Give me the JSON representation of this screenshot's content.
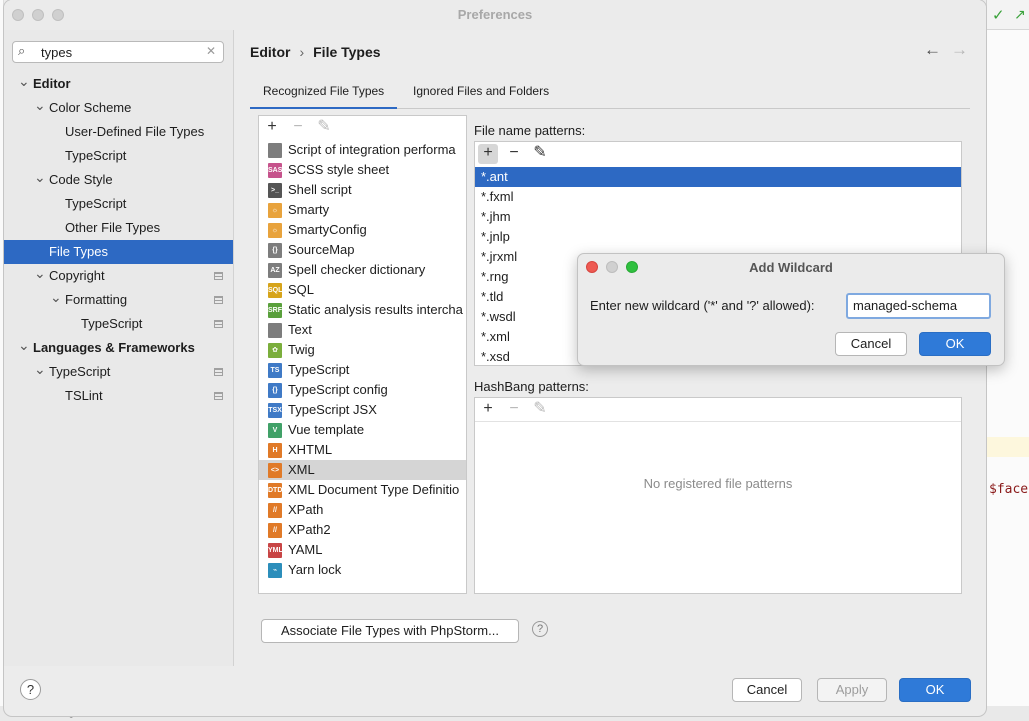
{
  "window": {
    "title": "Preferences"
  },
  "search": {
    "value": "types"
  },
  "sidebar": {
    "items": [
      {
        "label": "Editor",
        "level": 0,
        "expanded": true,
        "bold": true
      },
      {
        "label": "Color Scheme",
        "level": 1,
        "expanded": true
      },
      {
        "label": "User-Defined File Types",
        "level": 2
      },
      {
        "label": "TypeScript",
        "level": 2
      },
      {
        "label": "Code Style",
        "level": 1,
        "expanded": true
      },
      {
        "label": "TypeScript",
        "level": 2
      },
      {
        "label": "Other File Types",
        "level": 2
      },
      {
        "label": "File Types",
        "level": 1,
        "selected": true
      },
      {
        "label": "Copyright",
        "level": 1,
        "expanded": true,
        "project": true
      },
      {
        "label": "Formatting",
        "level": 2,
        "expanded": true,
        "project": true
      },
      {
        "label": "TypeScript",
        "level": 3,
        "project": true
      },
      {
        "label": "Languages & Frameworks",
        "level": 0,
        "expanded": true,
        "bold": true
      },
      {
        "label": "TypeScript",
        "level": 1,
        "expanded": true,
        "project": true
      },
      {
        "label": "TSLint",
        "level": 2,
        "project": true
      }
    ]
  },
  "breadcrumb": {
    "parent": "Editor",
    "separator": "›",
    "current": "File Types"
  },
  "nav": {
    "back": "←",
    "forward": "→"
  },
  "tabs": [
    {
      "label": "Recognized File Types",
      "active": true
    },
    {
      "label": "Ignored Files and Folders",
      "active": false
    }
  ],
  "toolbar": {
    "add": "+",
    "remove": "−",
    "edit": "✎"
  },
  "file_types": [
    {
      "name": "Script of integration performa",
      "icon": "script-icon",
      "tag": "",
      "color": "#7d7d7d"
    },
    {
      "name": "SCSS style sheet",
      "icon": "scss-icon",
      "tag": "SASS",
      "color": "#c6538c"
    },
    {
      "name": "Shell script",
      "icon": "shell-icon",
      "tag": ">_",
      "color": "#555555"
    },
    {
      "name": "Smarty",
      "icon": "smarty-icon",
      "tag": "☼",
      "color": "#e8a33d"
    },
    {
      "name": "SmartyConfig",
      "icon": "smarty-config-icon",
      "tag": "☼",
      "color": "#e8a33d"
    },
    {
      "name": "SourceMap",
      "icon": "sourcemap-icon",
      "tag": "{}",
      "color": "#7d7d7d"
    },
    {
      "name": "Spell checker dictionary",
      "icon": "dictionary-icon",
      "tag": "AZ",
      "color": "#7d7d7d"
    },
    {
      "name": "SQL",
      "icon": "sql-icon",
      "tag": "SQL",
      "color": "#d6a41b"
    },
    {
      "name": "Static analysis results intercha",
      "icon": "sarif-icon",
      "tag": "SRF",
      "color": "#5aa03c"
    },
    {
      "name": "Text",
      "icon": "text-icon",
      "tag": "",
      "color": "#7d7d7d"
    },
    {
      "name": "Twig",
      "icon": "twig-icon",
      "tag": "✿",
      "color": "#7bae3c"
    },
    {
      "name": "TypeScript",
      "icon": "typescript-icon",
      "tag": "TS",
      "color": "#3f7ac6"
    },
    {
      "name": "TypeScript config",
      "icon": "tsconfig-icon",
      "tag": "{}",
      "color": "#3f7ac6"
    },
    {
      "name": "TypeScript JSX",
      "icon": "tsx-icon",
      "tag": "TSX",
      "color": "#3f7ac6"
    },
    {
      "name": "Vue template",
      "icon": "vue-icon",
      "tag": "V",
      "color": "#41a168"
    },
    {
      "name": "XHTML",
      "icon": "xhtml-icon",
      "tag": "H",
      "color": "#e07a28"
    },
    {
      "name": "XML",
      "icon": "xml-icon",
      "tag": "<>",
      "color": "#e07a28",
      "selected": true
    },
    {
      "name": "XML Document Type Definitio",
      "icon": "dtd-icon",
      "tag": "DTD",
      "color": "#e07a28"
    },
    {
      "name": "XPath",
      "icon": "xpath-icon",
      "tag": "//",
      "color": "#e07a28"
    },
    {
      "name": "XPath2",
      "icon": "xpath2-icon",
      "tag": "//",
      "color": "#e07a28"
    },
    {
      "name": "YAML",
      "icon": "yaml-icon",
      "tag": "YML",
      "color": "#c84545"
    },
    {
      "name": "Yarn lock",
      "icon": "yarn-icon",
      "tag": "⌁",
      "color": "#2c8ebb"
    }
  ],
  "patterns": {
    "label": "File name patterns:",
    "items": [
      "*.ant",
      "*.fxml",
      "*.jhm",
      "*.jnlp",
      "*.jrxml",
      "*.rng",
      "*.tld",
      "*.wsdl",
      "*.xml",
      "*.xsd"
    ],
    "selected_index": 0
  },
  "hashbang": {
    "label": "HashBang patterns:",
    "empty_text": "No registered file patterns"
  },
  "associate_button": "Associate File Types with PhpStorm...",
  "associate_help": "?",
  "footer": {
    "help": "?",
    "cancel": "Cancel",
    "apply": "Apply",
    "ok": "OK"
  },
  "dialog": {
    "title": "Add Wildcard",
    "prompt": "Enter new wildcard ('*' and '?' allowed):",
    "input_value": "managed-schema",
    "cancel": "Cancel",
    "ok": "OK"
  },
  "background": {
    "code_text": "$face",
    "bottom_text": "tabase Changes      Problems      Services      Terminal"
  },
  "colors": {
    "accent": "#2d69c3",
    "primary_button": "#2f7ad8",
    "traffic_red": "#ee5a52",
    "traffic_yellow": "#d0d0d0",
    "traffic_green": "#2fc03f"
  }
}
